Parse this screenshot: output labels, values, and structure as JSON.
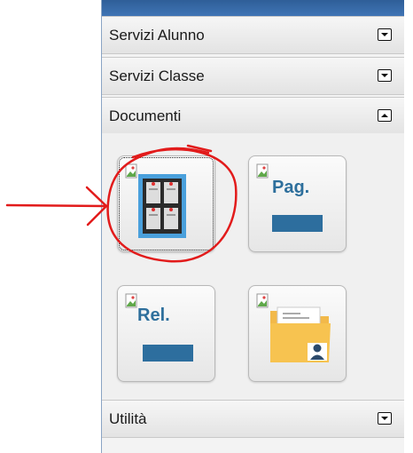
{
  "sections": [
    {
      "label": "Servizi Alunno",
      "expanded": false
    },
    {
      "label": "Servizi Classe",
      "expanded": false
    },
    {
      "label": "Documenti",
      "expanded": true
    },
    {
      "label": "Utilità",
      "expanded": false
    }
  ],
  "documenti": {
    "tiles": [
      {
        "icon": "bulletin-board-icon",
        "selected": true
      },
      {
        "icon": "pag-icon",
        "text": "Pag."
      },
      {
        "icon": "rel-icon",
        "text": "Rel."
      },
      {
        "icon": "folder-user-icon"
      }
    ]
  },
  "colors": {
    "header_bar": "#3f75b5",
    "tile_accent": "#2d6e9e",
    "annotation": "#e21b1b",
    "folder": "#f7c350"
  }
}
